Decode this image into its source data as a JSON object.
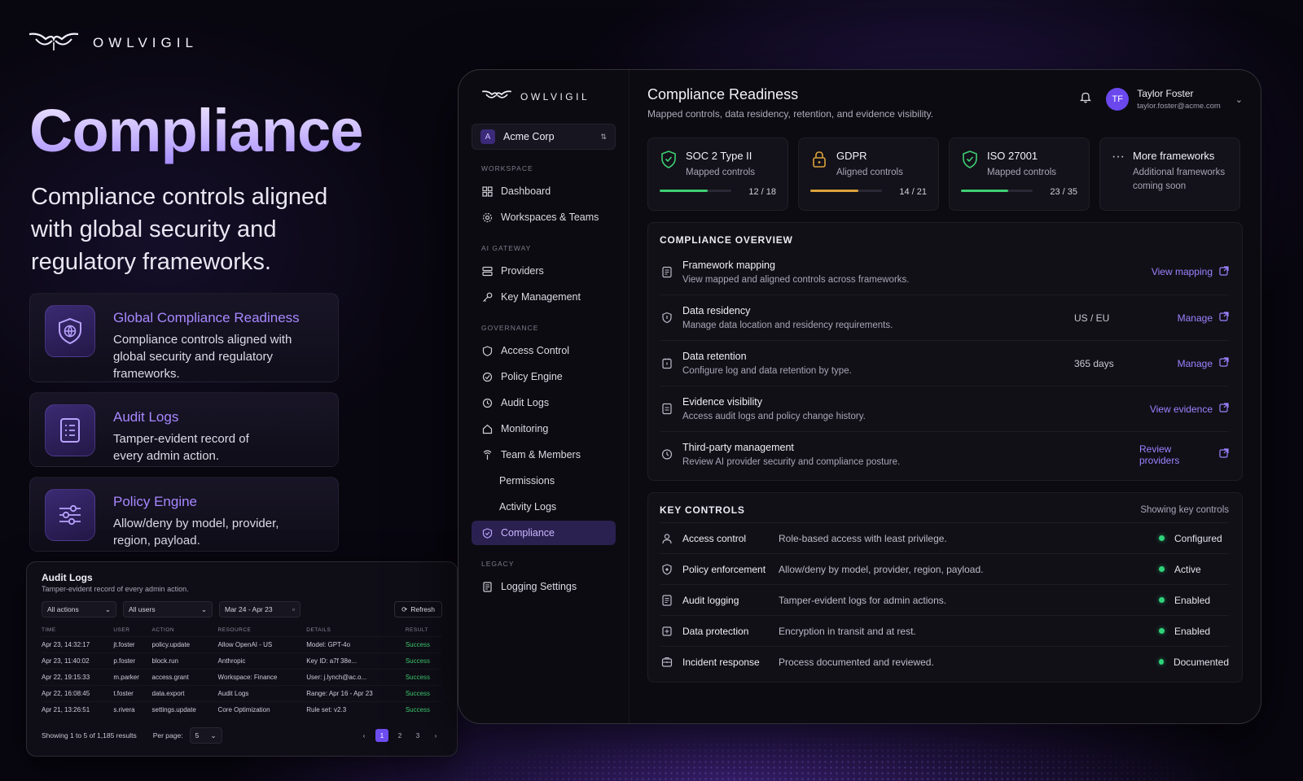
{
  "brand": {
    "name": "OWLVIGIL"
  },
  "hero": {
    "title": "Compliance",
    "subtitle": "Compliance controls aligned with global security and regulatory frameworks."
  },
  "features": [
    {
      "title": "Global Compliance Readiness",
      "desc": "Compliance controls aligned with global security and regulatory frameworks.",
      "icon": "shield-globe-icon"
    },
    {
      "title": "Audit Logs",
      "desc": "Tamper-evident record of every admin action.",
      "icon": "document-list-icon"
    },
    {
      "title": "Policy Engine",
      "desc": "Allow/deny by model, provider, region, payload.",
      "icon": "sliders-icon"
    }
  ],
  "audit_card": {
    "title": "Audit Logs",
    "subtitle": "Tamper-evident record of every admin action.",
    "filters": {
      "actions": "All actions",
      "users": "All users",
      "date": "Mar 24 - Apr 23",
      "refresh": "Refresh"
    },
    "columns": [
      "TIME",
      "USER",
      "ACTION",
      "RESOURCE",
      "DETAILS",
      "RESULT"
    ],
    "rows": [
      [
        "Apr 23, 14:32:17",
        "jt.foster",
        "policy.update",
        "Allow OpenAI - US",
        "Model: GPT-4o",
        "Success"
      ],
      [
        "Apr 23, 11:40:02",
        "p.foster",
        "block.run",
        "Anthropic",
        "Key ID: a7f 38e...",
        "Success"
      ],
      [
        "Apr 22, 19:15:33",
        "m.parker",
        "access.grant",
        "Workspace: Finance",
        "User: j.lynch@ac.o...",
        "Success"
      ],
      [
        "Apr 22, 16:08:45",
        "t.foster",
        "data.export",
        "Audit Logs",
        "Range: Apr 16 - Apr 23",
        "Success"
      ],
      [
        "Apr 21, 13:26:51",
        "s.rivera",
        "settings.update",
        "Core Optimization",
        "Rule set: v2.3",
        "Success"
      ]
    ],
    "footer": {
      "showing": "Showing 1 to 5 of 1,185 results",
      "per_page_label": "Per page:",
      "per_page": "5"
    },
    "pages": [
      "1",
      "2",
      "3"
    ]
  },
  "app": {
    "brand": "OWLVIGIL",
    "org": {
      "initial": "A",
      "name": "Acme Corp"
    },
    "sections": {
      "workspace": "WORKSPACE",
      "ai_gateway": "AI GATEWAY",
      "governance": "GOVERNANCE",
      "legacy": "LEGACY"
    },
    "nav": {
      "dashboard": "Dashboard",
      "workspaces": "Workspaces & Teams",
      "providers": "Providers",
      "keys": "Key Management",
      "access": "Access Control",
      "policy": "Policy Engine",
      "audit": "Audit Logs",
      "monitoring": "Monitoring",
      "team": "Team & Members",
      "permissions": "Permissions",
      "activity": "Activity Logs",
      "compliance": "Compliance",
      "logging": "Logging Settings"
    },
    "page_title": "Compliance Readiness",
    "page_subtitle": "Mapped controls, data residency, retention, and evidence visibility.",
    "user": {
      "initials": "TF",
      "name": "Taylor Foster",
      "email": "taylor.foster@acme.com"
    },
    "frameworks": [
      {
        "name": "SOC 2 Type II",
        "desc": "Mapped controls",
        "count": "12 / 18",
        "progress": 0.667,
        "color": "#3ecf73",
        "icon": "shield-check-icon"
      },
      {
        "name": "GDPR",
        "desc": "Aligned controls",
        "count": "14 / 21",
        "progress": 0.667,
        "color": "#d9a23a",
        "icon": "lock-icon"
      },
      {
        "name": "ISO 27001",
        "desc": "Mapped controls",
        "count": "23 / 35",
        "progress": 0.657,
        "color": "#3ecf73",
        "icon": "shield-check-icon"
      },
      {
        "name": "More frameworks",
        "desc": "Additional frameworks coming soon",
        "icon": "ellipsis-icon"
      }
    ],
    "overview": {
      "title": "COMPLIANCE OVERVIEW",
      "rows": [
        {
          "title": "Framework mapping",
          "desc": "View mapped and aligned controls across frameworks.",
          "value": "",
          "link": "View mapping"
        },
        {
          "title": "Data residency",
          "desc": "Manage data location and residency requirements.",
          "value": "US / EU",
          "link": "Manage"
        },
        {
          "title": "Data retention",
          "desc": "Configure log and data retention by type.",
          "value": "365 days",
          "link": "Manage"
        },
        {
          "title": "Evidence visibility",
          "desc": "Access audit logs and policy change history.",
          "value": "",
          "link": "View evidence"
        },
        {
          "title": "Third-party management",
          "desc": "Review AI provider security and compliance posture.",
          "value": "",
          "link": "Review providers"
        }
      ]
    },
    "key_controls": {
      "title": "KEY CONTROLS",
      "note": "Showing key controls",
      "rows": [
        {
          "name": "Access control",
          "desc": "Role-based access with least privilege.",
          "status": "Configured"
        },
        {
          "name": "Policy enforcement",
          "desc": "Allow/deny by model, provider, region, payload.",
          "status": "Active"
        },
        {
          "name": "Audit logging",
          "desc": "Tamper-evident logs for admin actions.",
          "status": "Enabled"
        },
        {
          "name": "Data protection",
          "desc": "Encryption in transit and at rest.",
          "status": "Enabled"
        },
        {
          "name": "Incident response",
          "desc": "Process documented and reviewed.",
          "status": "Documented"
        }
      ]
    }
  }
}
